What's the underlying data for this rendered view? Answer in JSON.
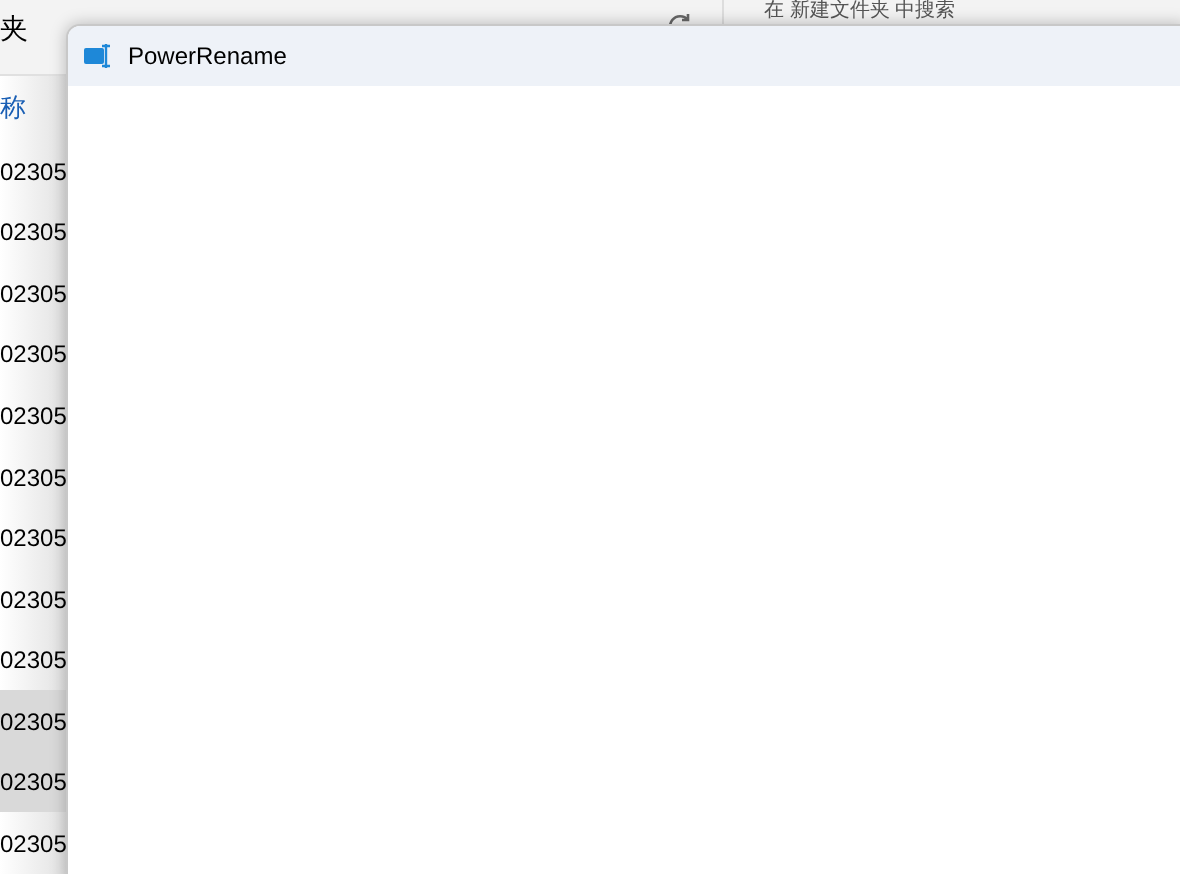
{
  "background_window": {
    "address_tail": "夹",
    "search_placeholder": "在 新建文件夹 中搜索",
    "column_header": "称",
    "rows": [
      {
        "name": "02305",
        "selected": false
      },
      {
        "name": "02305",
        "selected": false
      },
      {
        "name": "02305",
        "selected": false
      },
      {
        "name": "02305",
        "selected": false
      },
      {
        "name": "02305",
        "selected": false
      },
      {
        "name": "02305",
        "selected": false
      },
      {
        "name": "02305",
        "selected": false
      },
      {
        "name": "02305",
        "selected": false
      },
      {
        "name": "02305",
        "selected": false
      },
      {
        "name": "02305",
        "selected": true
      },
      {
        "name": "02305",
        "selected": true
      },
      {
        "name": "02305",
        "selected": false
      }
    ]
  },
  "window": {
    "title": "PowerRename"
  }
}
